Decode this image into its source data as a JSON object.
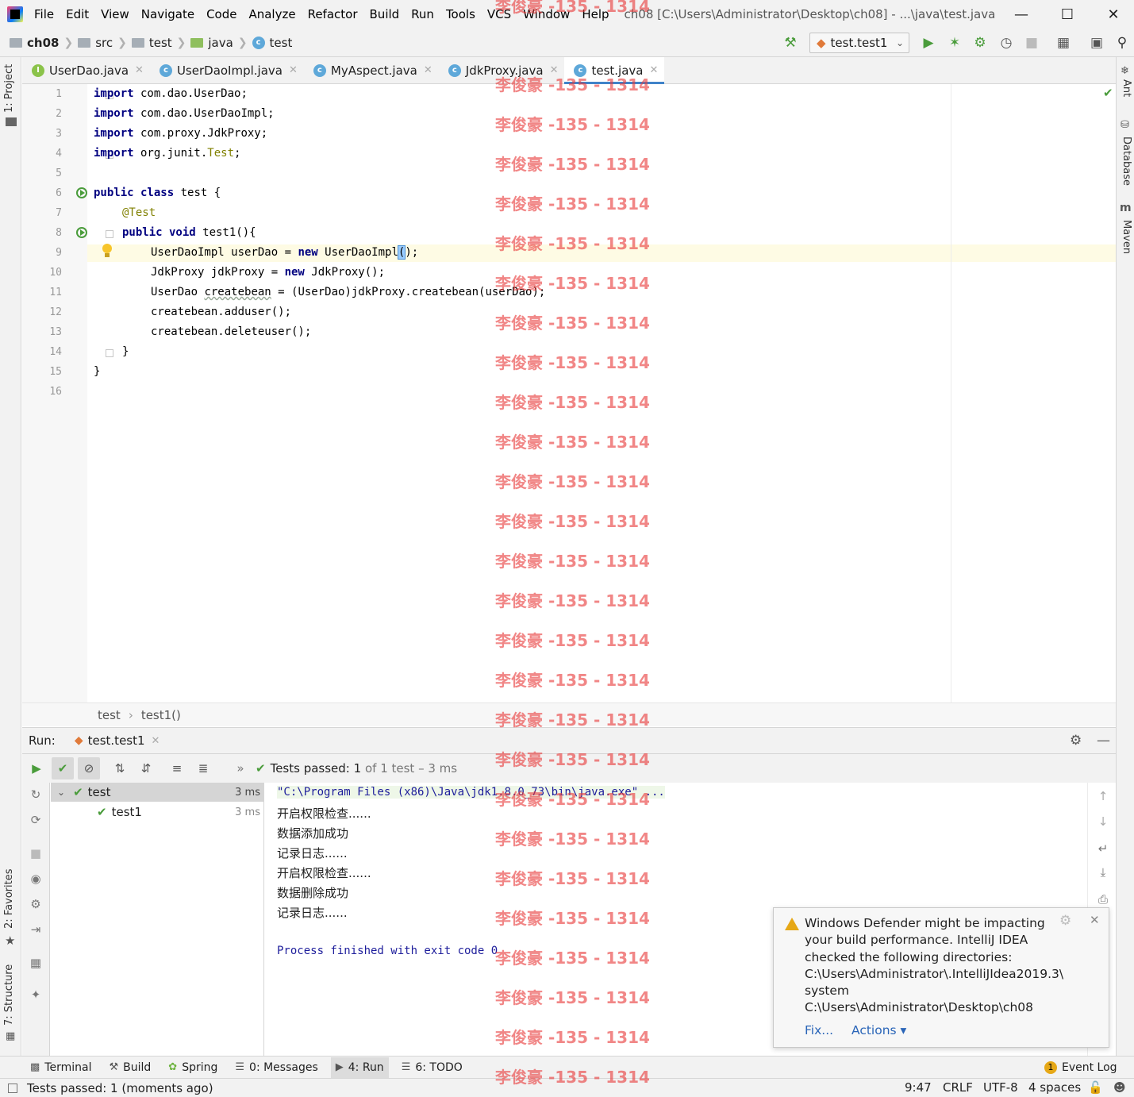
{
  "menu": [
    "File",
    "Edit",
    "View",
    "Navigate",
    "Code",
    "Analyze",
    "Refactor",
    "Build",
    "Run",
    "Tools",
    "VCS",
    "Window",
    "Help"
  ],
  "window_title": "ch08 [C:\\Users\\Administrator\\Desktop\\ch08] - ...\\java\\test.java",
  "breadcrumbs": [
    "ch08",
    "src",
    "test",
    "java",
    "test"
  ],
  "run_config": "test.test1",
  "left_tool_tabs": {
    "project": "1: Project",
    "favorites": "2: Favorites",
    "structure": "7: Structure"
  },
  "right_tool_tabs": {
    "ant": "Ant",
    "database": "Database",
    "maven": "Maven"
  },
  "editor_tabs": [
    {
      "label": "UserDao.java",
      "icon": "interface-icon"
    },
    {
      "label": "UserDaoImpl.java",
      "icon": "class-icon"
    },
    {
      "label": "MyAspect.java",
      "icon": "class-icon"
    },
    {
      "label": "JdkProxy.java",
      "icon": "class-icon"
    },
    {
      "label": "test.java",
      "icon": "class-icon",
      "active": true
    }
  ],
  "line_numbers": [
    "1",
    "2",
    "3",
    "4",
    "5",
    "6",
    "7",
    "8",
    "9",
    "10",
    "11",
    "12",
    "13",
    "14",
    "15",
    "16"
  ],
  "code": {
    "l1_kw": "import",
    "l1": " com.dao.UserDao;",
    "l2_kw": "import",
    "l2": " com.dao.UserDaoImpl;",
    "l3_kw": "import",
    "l3": " com.proxy.JdkProxy;",
    "l4_kw": "import",
    "l4": " org.junit.",
    "l4_ann": "Test",
    "l4_end": ";",
    "l6_kw": "public class",
    "l6": " test {",
    "l7_ann": "@Test",
    "l8_kw": "public void",
    "l8": " test1(){",
    "l9_a": "UserDaoImpl userDao = ",
    "l9_kw": "new",
    "l9_b": " UserDaoImpl",
    "l9_paren": "(",
    "l9_c": ");",
    "l10_a": "JdkProxy jdkProxy = ",
    "l10_kw": "new",
    "l10_b": " JdkProxy();",
    "l11_a": "UserDao ",
    "l11_var": "createbean",
    "l11_b": " = (UserDao)jdkProxy.createbean(userDao);",
    "l12": "createbean.adduser();",
    "l13": "createbean.deleteuser();",
    "l14": "}",
    "l15": "}"
  },
  "editor_breadcrumb": [
    "test",
    "test1()"
  ],
  "run_panel": {
    "label": "Run:",
    "tab": "test.test1",
    "status_prefix": "Tests passed:",
    "status_count": "1",
    "status_suffix": "of 1 test – 3 ms",
    "tree": [
      {
        "name": "test",
        "time": "3 ms"
      },
      {
        "name": "test1",
        "time": "3 ms"
      }
    ],
    "console": [
      "\"C:\\Program Files (x86)\\Java\\jdk1.8.0_73\\bin\\java.exe\" ...",
      "开启权限检查......",
      "数据添加成功",
      "记录日志......",
      "开启权限检查......",
      "数据删除成功",
      "记录日志......",
      "",
      "Process finished with exit code 0"
    ]
  },
  "notification": {
    "text": "Windows Defender might be impacting your build performance. IntelliJ IDEA checked the following directories:",
    "dir1": "C:\\Users\\Administrator\\.IntelliJIdea2019.3\\system",
    "dir2": "C:\\Users\\Administrator\\Desktop\\ch08",
    "fix": "Fix...",
    "actions": "Actions ▾"
  },
  "bottom_tools": [
    {
      "label": "Terminal",
      "icon": "terminal-icon"
    },
    {
      "label": "Build",
      "icon": "hammer-icon"
    },
    {
      "label": "Spring",
      "icon": "spring-icon"
    },
    {
      "label": "0: Messages",
      "icon": "messages-icon"
    },
    {
      "label": "4: Run",
      "icon": "run-icon",
      "active": true
    },
    {
      "label": "6: TODO",
      "icon": "todo-icon"
    }
  ],
  "event_log": {
    "badge": "1",
    "label": "Event Log"
  },
  "status_bar": {
    "message": "Tests passed: 1 (moments ago)",
    "position": "9:47",
    "line_sep": "CRLF",
    "encoding": "UTF-8",
    "indent": "4 spaces"
  },
  "watermark": "李俊豪 -135 - 1314",
  "colors": {
    "accent": "#4083c9",
    "pass_green": "#4a9c3b",
    "keyword": "#000080",
    "annotation": "#808000",
    "watermark": "#e83c3c"
  }
}
